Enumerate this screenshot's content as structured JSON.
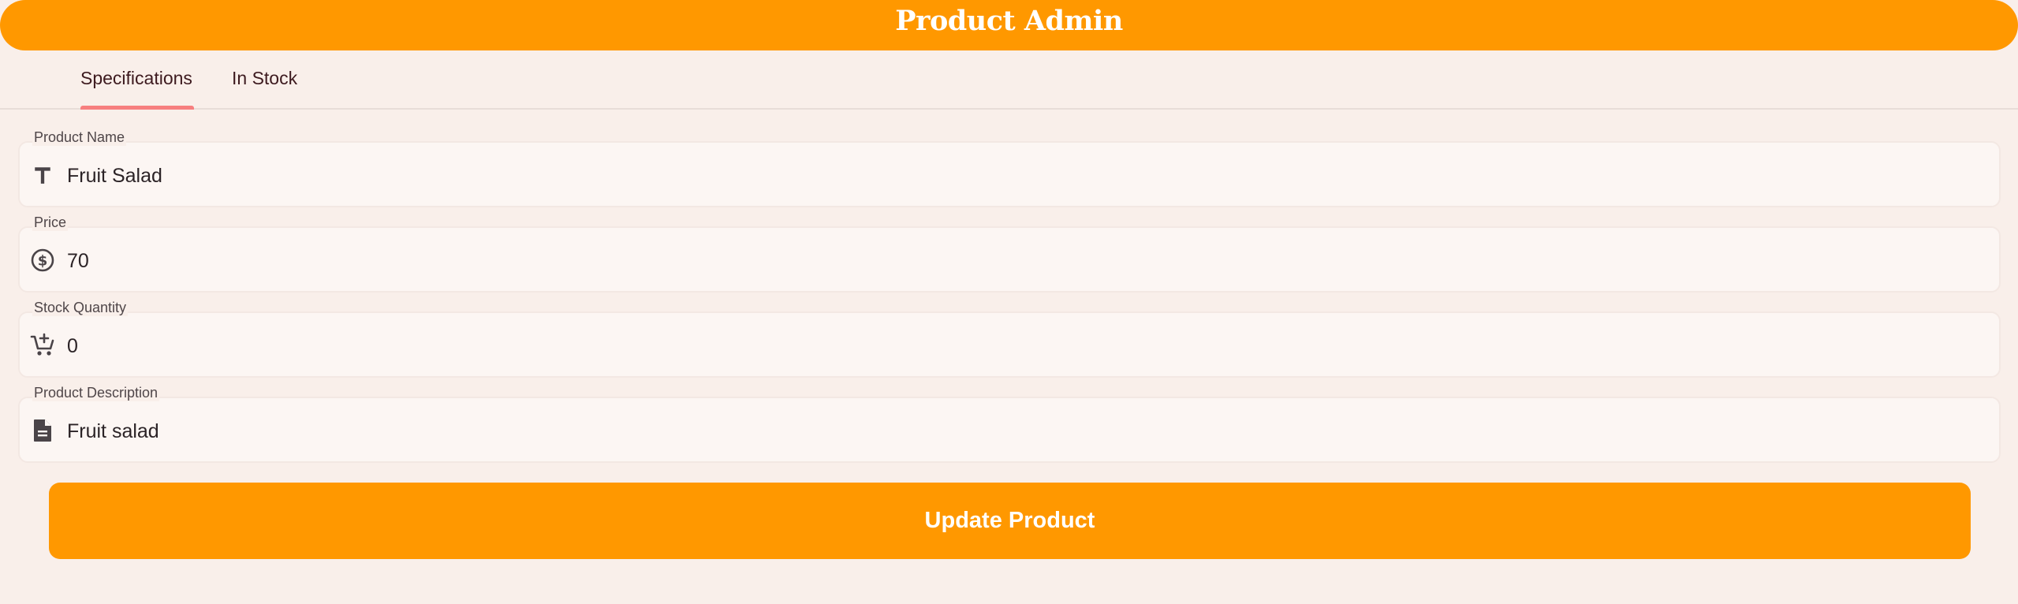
{
  "app": {
    "title": "Product Admin"
  },
  "tabs": [
    {
      "label": "Specifications",
      "selected": true
    },
    {
      "label": "In Stock",
      "selected": false
    }
  ],
  "form": {
    "fields": [
      {
        "label": "Product Name",
        "value": "Fruit Salad",
        "icon": "text-icon"
      },
      {
        "label": "Price",
        "value": "70",
        "icon": "dollar-circle-icon"
      },
      {
        "label": "Stock Quantity",
        "value": "0",
        "icon": "cart-add-icon"
      },
      {
        "label": "Product Description",
        "value": "Fruit salad",
        "icon": "document-icon"
      }
    ],
    "submit_label": "Update Product"
  },
  "colors": {
    "accent": "#ff9800",
    "tab_indicator": "#f77f7f",
    "background": "#f9efea",
    "field_background": "#fcf6f3"
  }
}
